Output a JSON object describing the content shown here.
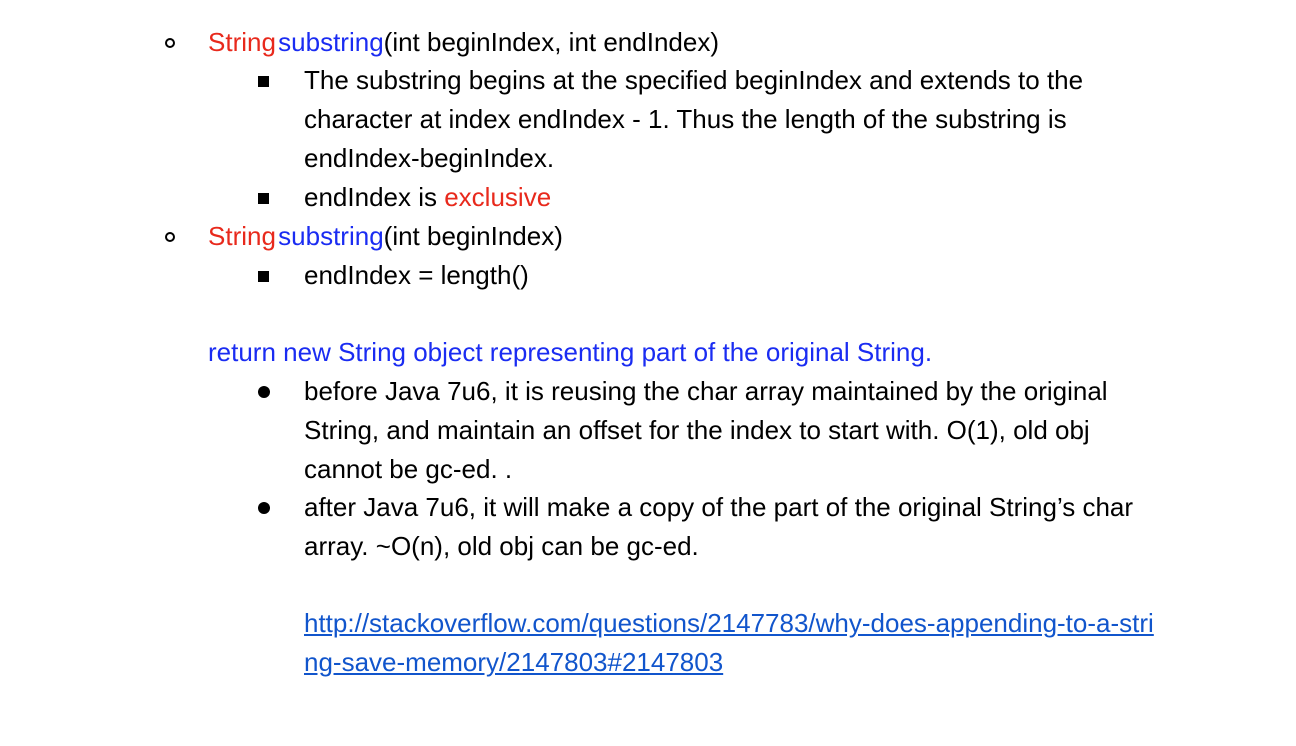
{
  "colors": {
    "red": "#e8291c",
    "blue": "#1a2cf2",
    "link": "#1155cc",
    "text": "#000000"
  },
  "method1": {
    "type_word": "String",
    "name_word": "substring",
    "params": "(int beginIndex, int endIndex)",
    "detail1_line1": "The substring begins at the specified beginIndex and extends to the",
    "detail1_line2": "character at index endIndex - 1. Thus the length of the substring is",
    "detail1_line3": "endIndex-beginIndex.",
    "detail2_prefix": "endIndex is ",
    "detail2_highlight": "exclusive"
  },
  "method2": {
    "type_word": "String",
    "name_word": "substring",
    "params": "(int beginIndex)",
    "detail1": "endIndex = length()"
  },
  "return_note": "return new String object representing part of the original String.",
  "notes": {
    "before_line1": "before Java 7u6, it is reusing the char array maintained by the original",
    "before_line2": "String, and maintain an offset for the index to start with. O(1), old obj",
    "before_line3": "cannot be gc-ed. .",
    "after_line1": "after Java 7u6, it will make a copy of the part of the original String’s char",
    "after_line2": "array. ~O(n), old obj can be gc-ed."
  },
  "link": {
    "line1": "http://stackoverflow.com/questions/2147783/why-does-appending-to-a-stri",
    "line2": "ng-save-memory/2147803#2147803"
  }
}
